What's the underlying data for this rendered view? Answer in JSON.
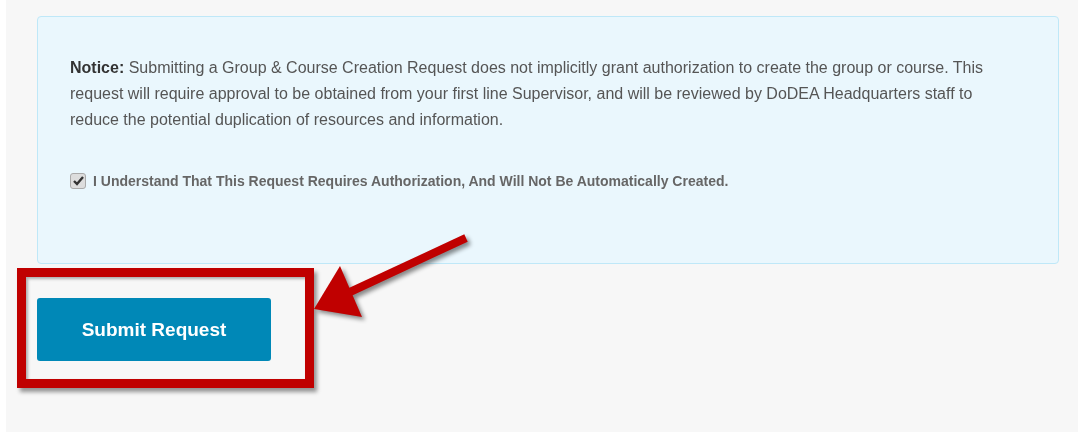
{
  "notice": {
    "text": "**Notice:** Submitting a Group & Course Creation Request does not implicitly grant authorization to create the group or course. This request will require approval to be obtained from your first line Supervisor, and will be reviewed by DoDEA Headquarters staff to reduce the potential duplication of resources and information."
  },
  "acknowledgement": {
    "label": "I Understand That This Request Requires Authorization, And Will Not Be Automatically Created.",
    "checked": true
  },
  "submit_button": {
    "label": "Submit Request"
  }
}
